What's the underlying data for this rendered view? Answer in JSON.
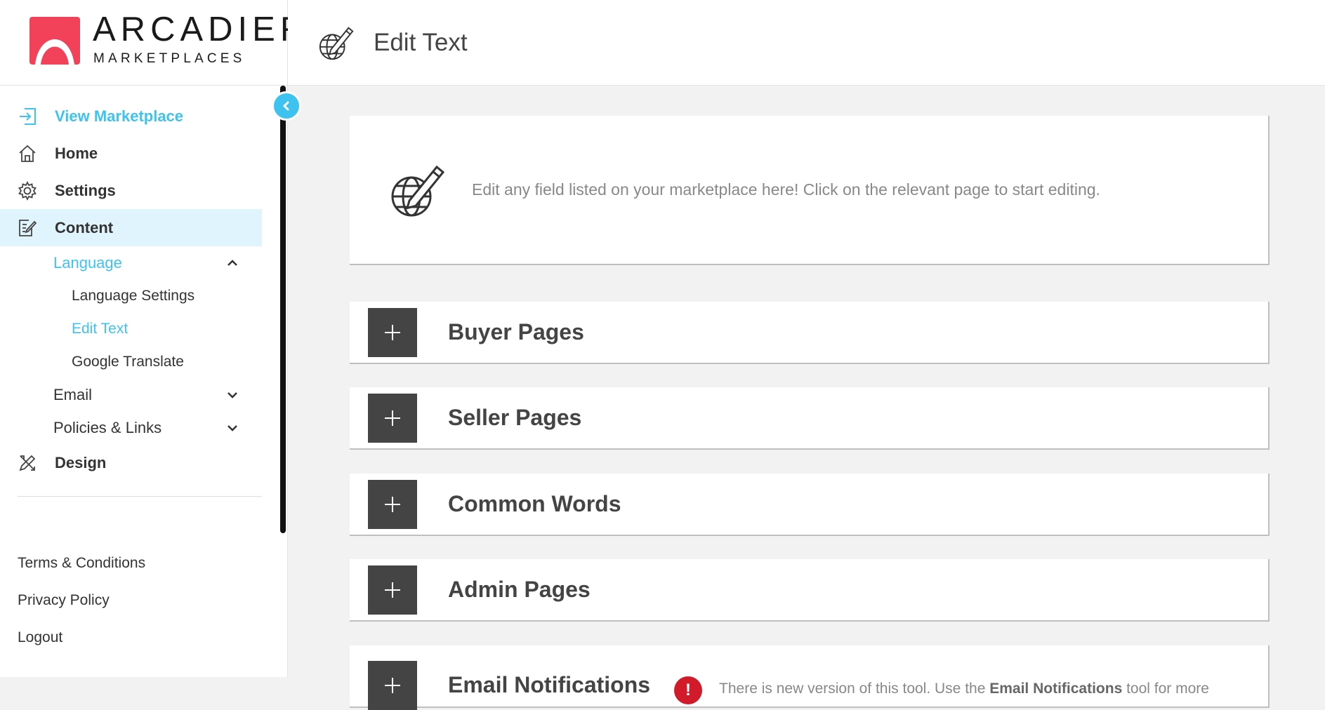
{
  "brand": {
    "name": "ARCADIER",
    "tagline": "MARKETPLACES",
    "accent": "#3ec3f1",
    "logo_red": "#f2425a"
  },
  "header": {
    "title": "Edit Text",
    "icon": "globe-pencil-icon"
  },
  "sidebar": {
    "items": [
      {
        "label": "View Marketplace",
        "icon": "enter-icon"
      },
      {
        "label": "Home",
        "icon": "home-icon"
      },
      {
        "label": "Settings",
        "icon": "gear-icon"
      },
      {
        "label": "Content",
        "icon": "edit-document-icon"
      }
    ],
    "content_sub": {
      "language": {
        "label": "Language",
        "children": [
          "Language Settings",
          "Edit Text",
          "Google Translate"
        ]
      },
      "email": {
        "label": "Email"
      },
      "policies": {
        "label": "Policies & Links"
      }
    },
    "design": {
      "label": "Design",
      "icon": "pencil-ruler-icon"
    },
    "footer": [
      "Terms & Conditions",
      "Privacy Policy",
      "Logout"
    ]
  },
  "intro": {
    "text": "Edit any field listed on your marketplace here! Click on the relevant page to start editing."
  },
  "sections": [
    "Buyer Pages",
    "Seller Pages",
    "Common Words",
    "Admin Pages",
    "Email Notifications"
  ],
  "notice": {
    "icon_text": "!",
    "pre": "There is new version of this tool. Use the ",
    "bold": "Email Notifications",
    "post": " tool for more"
  }
}
